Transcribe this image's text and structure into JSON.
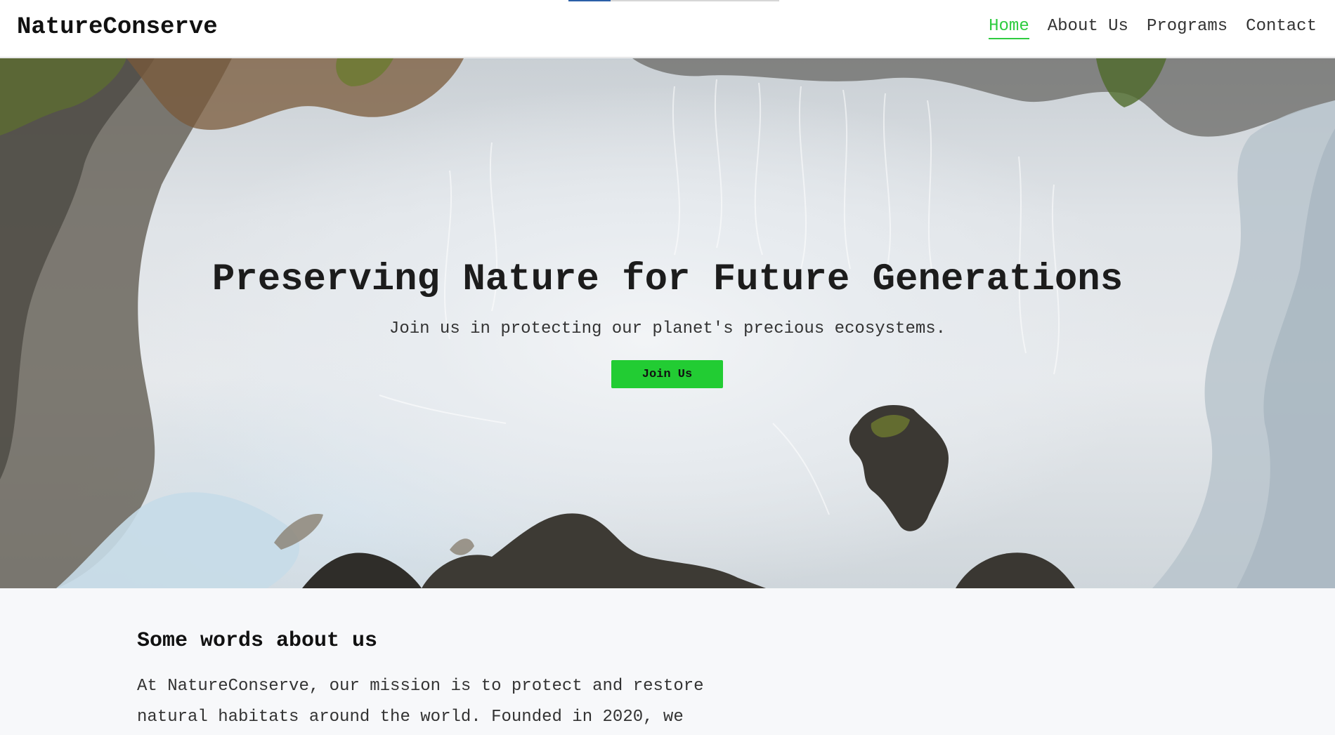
{
  "header": {
    "brand": "NatureConserve",
    "nav": [
      {
        "label": "Home",
        "active": true
      },
      {
        "label": "About Us",
        "active": false
      },
      {
        "label": "Programs",
        "active": false
      },
      {
        "label": "Contact",
        "active": false
      }
    ]
  },
  "hero": {
    "title": "Preserving Nature for Future Generations",
    "subtitle": "Join us in protecting our planet's precious ecosystems.",
    "cta_label": "Join Us",
    "image_icon": "aerial-glacier-landscape-image"
  },
  "about": {
    "heading": "Some words about us",
    "text": "At NatureConserve, our mission is to protect and restore natural habitats around the world. Founded in 2020, we"
  },
  "colors": {
    "accent": "#2ecc40",
    "button": "#22cc33",
    "header_bg": "#ffffff",
    "page_bg": "#f7f8fa"
  }
}
